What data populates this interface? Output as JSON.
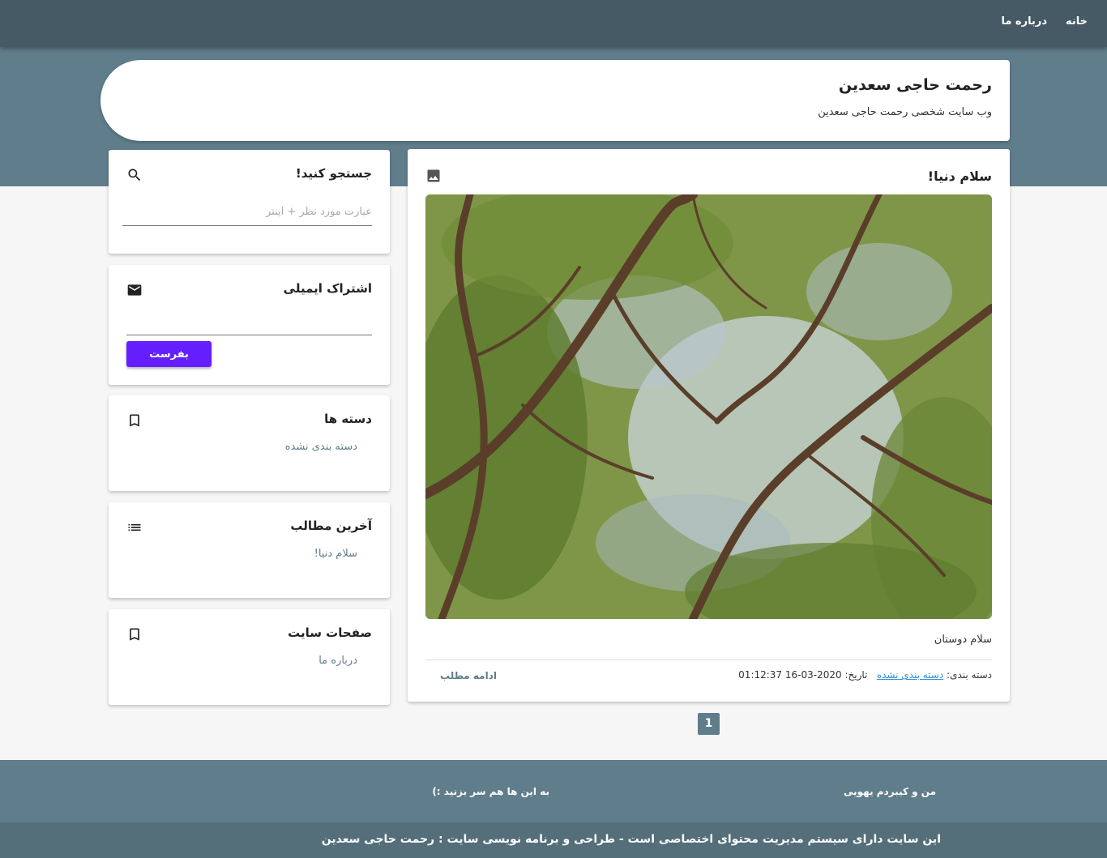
{
  "nav": {
    "home": "خانه",
    "about": "درباره ما"
  },
  "header": {
    "site_title": "رحمت حاجی سعدین",
    "tagline": "وب سایت شخصی رحمت حاجی سعدین"
  },
  "sidebar": {
    "search": {
      "title": "جستجو کنید!",
      "placeholder": "عبارت مورد نظر + اینتر",
      "icon": "search-icon"
    },
    "subscribe": {
      "title": "اشتراک ایمیلی",
      "button": "بفرست",
      "icon": "mail-icon"
    },
    "categories": {
      "title": "دسته ها",
      "items": [
        "دسته بندی نشده"
      ],
      "icon": "bookmark-icon"
    },
    "recent_posts": {
      "title": "آخرین مطالب",
      "items": [
        "سلام دنیا!"
      ],
      "icon": "list-icon"
    },
    "pages": {
      "title": "صفحات سایت",
      "items": [
        "درباره ما"
      ],
      "icon": "bookmark-icon"
    }
  },
  "post": {
    "title": "سلام دنیا!",
    "excerpt": "سلام دوستان",
    "category_label": "دسته بندی:",
    "category": "دسته بندی نشده",
    "date_label": "تاریخ:",
    "date": "01:12:37 16-03-2020",
    "read_more": "ادامه مطلب",
    "icon": "image-icon"
  },
  "pagination": {
    "current": "1"
  },
  "footer": {
    "col_right": "من و کیبردم یهویی",
    "col_left": "به این ها هم سر بزنید :)",
    "copyright": "این سایت دارای سیستم مدیریت محتوای اختصاصی است - طراحی و برنامه نویسی سایت : رحمت حاجی سعدین"
  },
  "colors": {
    "nav_bg": "#455a64",
    "hero_bg": "#607d8b",
    "accent_button": "#651fff",
    "link": "#607d8b",
    "category_link": "#2f8fd8",
    "footer_bottom": "#546e7a"
  }
}
